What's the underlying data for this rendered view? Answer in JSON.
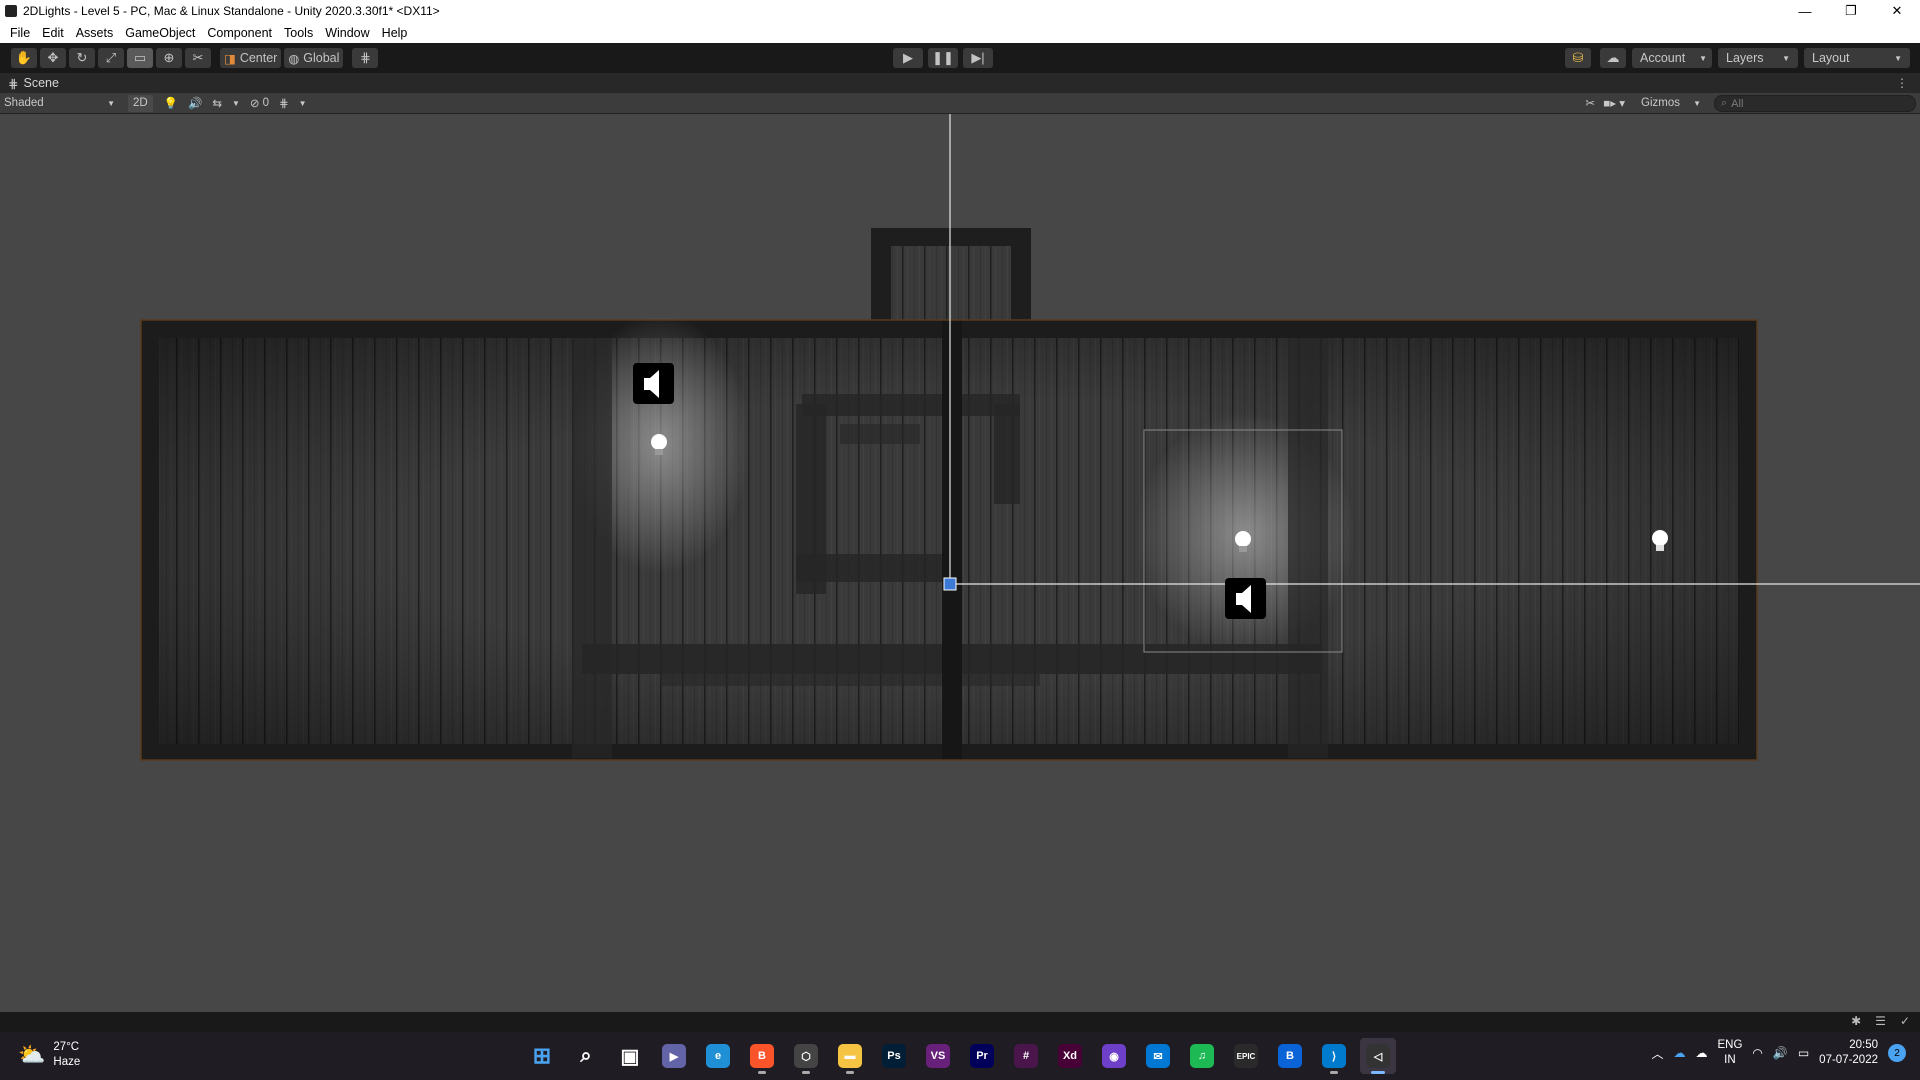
{
  "window": {
    "title": "2DLights - Level 5 - PC, Mac & Linux Standalone - Unity 2020.3.30f1* <DX11>",
    "controls": [
      "—",
      "❐",
      "✕"
    ]
  },
  "menu": [
    "File",
    "Edit",
    "Assets",
    "GameObject",
    "Component",
    "Tools",
    "Window",
    "Help"
  ],
  "toolbar": {
    "pivot_label": "Center",
    "space_label": "Global",
    "account_label": "Account",
    "layers_label": "Layers",
    "layout_label": "Layout"
  },
  "scene_tab": {
    "label": "Scene"
  },
  "scene_bar": {
    "draw_mode": "Shaded",
    "mode_2d": "2D",
    "hidden_count": "0",
    "gizmos_label": "Gizmos",
    "search_placeholder": "All"
  },
  "taskbar": {
    "weather_temp": "27°C",
    "weather_desc": "Haze",
    "apps": [
      {
        "name": "start",
        "label": "⊞",
        "color": "#4aa3f0"
      },
      {
        "name": "search",
        "label": "⌕",
        "color": "transparent"
      },
      {
        "name": "task-view",
        "label": "▣",
        "color": "transparent"
      },
      {
        "name": "teams",
        "label": "▶",
        "color": "#6264a7"
      },
      {
        "name": "edge",
        "label": "e",
        "color": "#1f8fd6"
      },
      {
        "name": "brave",
        "label": "B",
        "color": "#fb542b"
      },
      {
        "name": "unity-hub",
        "label": "⬡",
        "color": "#444"
      },
      {
        "name": "file-explorer",
        "label": "▬",
        "color": "#f4c442"
      },
      {
        "name": "photoshop",
        "label": "Ps",
        "color": "#001e36"
      },
      {
        "name": "visual-studio",
        "label": "VS",
        "color": "#68217a"
      },
      {
        "name": "premiere",
        "label": "Pr",
        "color": "#00005b"
      },
      {
        "name": "slack",
        "label": "#",
        "color": "#4a154b"
      },
      {
        "name": "xd",
        "label": "Xd",
        "color": "#470137"
      },
      {
        "name": "github",
        "label": "◉",
        "color": "#6e40c9"
      },
      {
        "name": "mail",
        "label": "✉",
        "color": "#0078d4"
      },
      {
        "name": "spotify",
        "label": "♫",
        "color": "#1db954"
      },
      {
        "name": "epic-games",
        "label": "EPIC",
        "color": "#2a2a2a"
      },
      {
        "name": "b-app",
        "label": "B",
        "color": "#0a64d8"
      },
      {
        "name": "vscode",
        "label": "⟩",
        "color": "#007acc"
      },
      {
        "name": "unity",
        "label": "◁",
        "color": "#333"
      }
    ],
    "lang_top": "ENG",
    "lang_bottom": "IN",
    "time": "20:50",
    "date": "07-07-2022",
    "notification_count": "2"
  },
  "colors": {
    "editor_bg": "#464646",
    "toolbar_bg": "#191919",
    "taskbar_bg": "#201c24",
    "accent": "#4aa3f0"
  }
}
